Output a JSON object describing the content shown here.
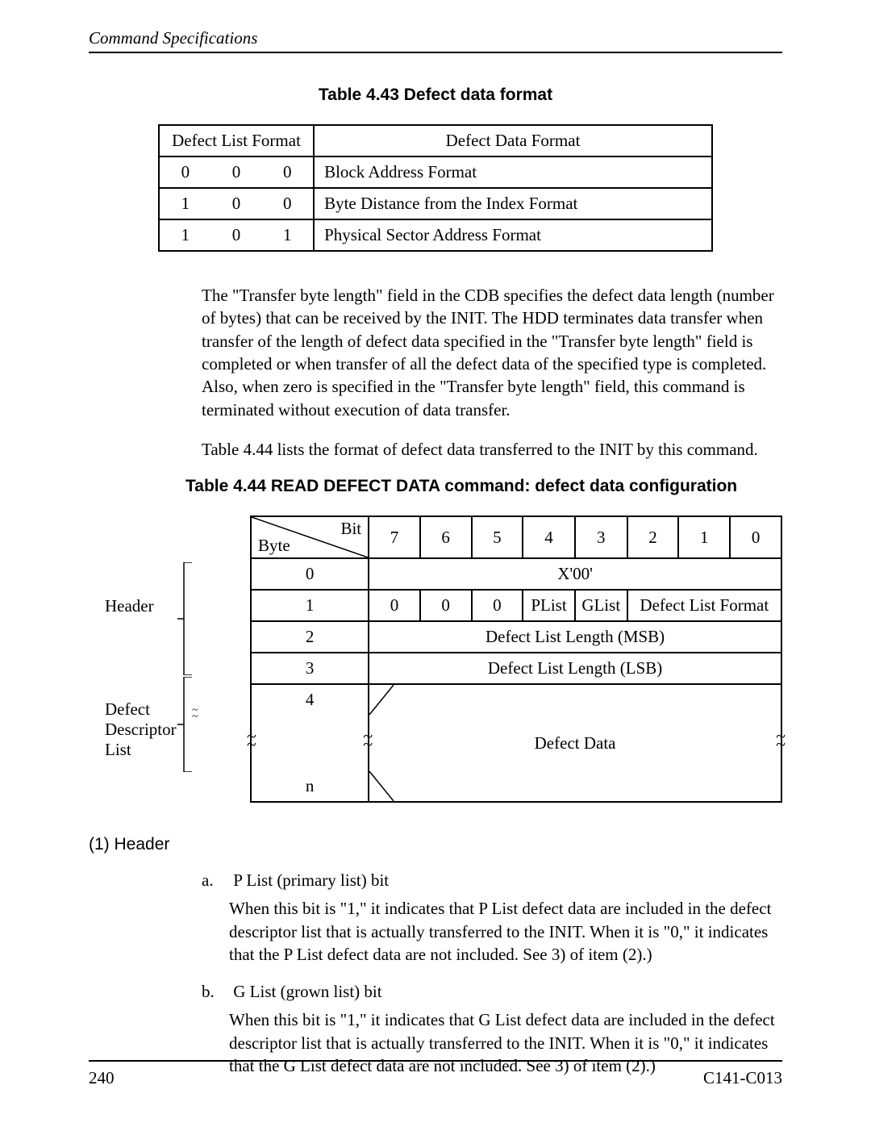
{
  "header": {
    "left": "Command Specifications",
    "right": ""
  },
  "table43": {
    "title": "Table 4.43  Defect data format",
    "head_left": "Defect List Format",
    "head_right": "Defect Data Format",
    "rows": [
      {
        "b0": "0",
        "b1": "0",
        "b2": "0",
        "desc": "Block Address Format"
      },
      {
        "b0": "1",
        "b1": "0",
        "b2": "0",
        "desc": "Byte Distance from the Index Format"
      },
      {
        "b0": "1",
        "b1": "0",
        "b2": "1",
        "desc": "Physical Sector Address Format"
      }
    ]
  },
  "para1": "The \"Transfer byte length\" field in the CDB specifies the defect data length (number of bytes) that can be received by the INIT.  The HDD terminates data transfer when transfer of the length of defect data specified in the \"Transfer byte length\" field is completed or when transfer of all the defect data of the specified type is completed.  Also, when zero is specified in the \"Transfer byte length\" field, this command is terminated without execution of data transfer.",
  "para2": "Table 4.44 lists the format of defect data transferred to the INIT by this command.",
  "table44": {
    "title": "Table 4.44  READ DEFECT DATA command:  defect data configuration",
    "bit_label": "Bit",
    "byte_label": "Byte",
    "bits": [
      "7",
      "6",
      "5",
      "4",
      "3",
      "2",
      "1",
      "0"
    ],
    "row_labels": {
      "r0": "0",
      "r1": "1",
      "r2": "2",
      "r3": "3",
      "r4": "4",
      "rn": "n"
    },
    "row0_val": "X'00'",
    "row1": {
      "b7": "0",
      "b6": "0",
      "b5": "0",
      "b4": "PList",
      "b3": "GList",
      "dlf": "Defect List Format"
    },
    "row2_val": "Defect List Length (MSB)",
    "row3_val": "Defect List Length (LSB)",
    "defect_data": "Defect Data",
    "side_labels": {
      "header": "Header",
      "descriptor": "Defect Descriptor List"
    }
  },
  "section1": "(1)  Header",
  "item_a": {
    "letter": "a.",
    "title": "P List (primary list) bit",
    "body": "When this bit is \"1,\" it indicates that P List defect data are included in the defect descriptor list that is actually transferred to the INIT.  When it is \"0,\" it indicates that the P List defect data are not included.  See 3) of item (2).)"
  },
  "item_b": {
    "letter": "b.",
    "title": "G List (grown list) bit",
    "body": "When this bit is \"1,\" it indicates that G List defect data are included in the defect descriptor list that is actually transferred to the INIT.  When it is \"0,\" it indicates that the G List defect data are not included.  See 3) of item (2).)"
  },
  "footer": {
    "page": "240",
    "doc": "C141-C013"
  }
}
